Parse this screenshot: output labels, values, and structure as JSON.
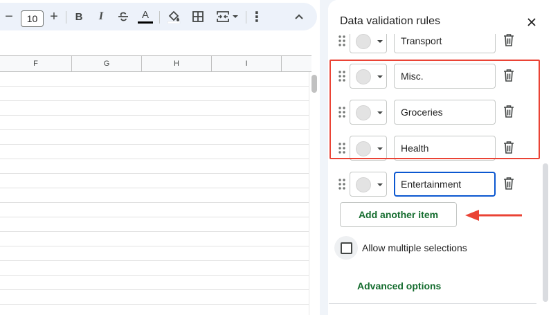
{
  "toolbar": {
    "font_size": "10",
    "minus_glyph": "−",
    "plus_glyph": "+",
    "bold_glyph": "B",
    "italic_glyph": "I",
    "text_color_glyph": "A",
    "more_glyph": "⋮",
    "collapse_glyph": "⌃"
  },
  "sheet": {
    "columns": [
      "F",
      "G",
      "H",
      "I"
    ]
  },
  "panel": {
    "title": "Data validation rules",
    "close_glyph": "✕",
    "items": [
      {
        "value": "Transport"
      },
      {
        "value": "Misc."
      },
      {
        "value": "Groceries"
      },
      {
        "value": "Health"
      },
      {
        "value": "Entertainment"
      }
    ],
    "add_item_label": "Add another item",
    "multi_select_label": "Allow multiple selections",
    "advanced_label": "Advanced options"
  },
  "colors": {
    "highlight": "#ea4335",
    "accent_green": "#146c2e",
    "focus_blue": "#0b57d0"
  }
}
